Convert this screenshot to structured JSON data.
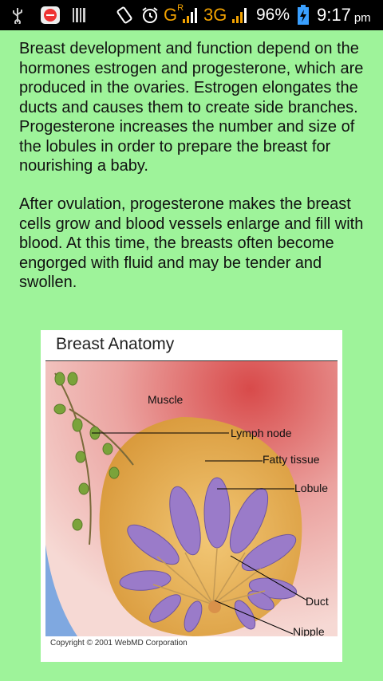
{
  "status_bar": {
    "network": "G",
    "network_sup": "R",
    "network2": "3G",
    "battery": "96%",
    "time": "9:17",
    "ampm": "pm",
    "icons": [
      "usb-icon",
      "app-notification-icon",
      "barcode-icon",
      "rotate-icon",
      "alarm-icon",
      "signal-icon",
      "signal2-icon",
      "battery-charging-icon"
    ]
  },
  "article": {
    "paragraph1": "Breast development and function depend on the hormones estrogen and progesterone, which are produced in the ovaries. Estrogen elongates the ducts and causes them to create side branches. Progesterone increases the number and size of the lobules in order to prepare the breast for nourishing a baby.",
    "paragraph2": "After ovulation, progesterone makes the breast cells grow and blood vessels enlarge and fill with blood. At this time, the breasts often become engorged with fluid and may be tender and swollen."
  },
  "figure": {
    "title": "Breast Anatomy",
    "labels": {
      "muscle": "Muscle",
      "lymph_node": "Lymph node",
      "fatty_tissue": "Fatty tissue",
      "lobule": "Lobule",
      "duct": "Duct",
      "nipple": "Nipple"
    },
    "copyright": "Copyright © 2001 WebMD Corporation"
  },
  "colors": {
    "background": "#9ef39a",
    "status_bar": "#000000",
    "network_accent": "#f2a200",
    "battery_accent": "#3aa0ff",
    "lobule": "#9a7bc9",
    "fat": "#e9b15a"
  }
}
